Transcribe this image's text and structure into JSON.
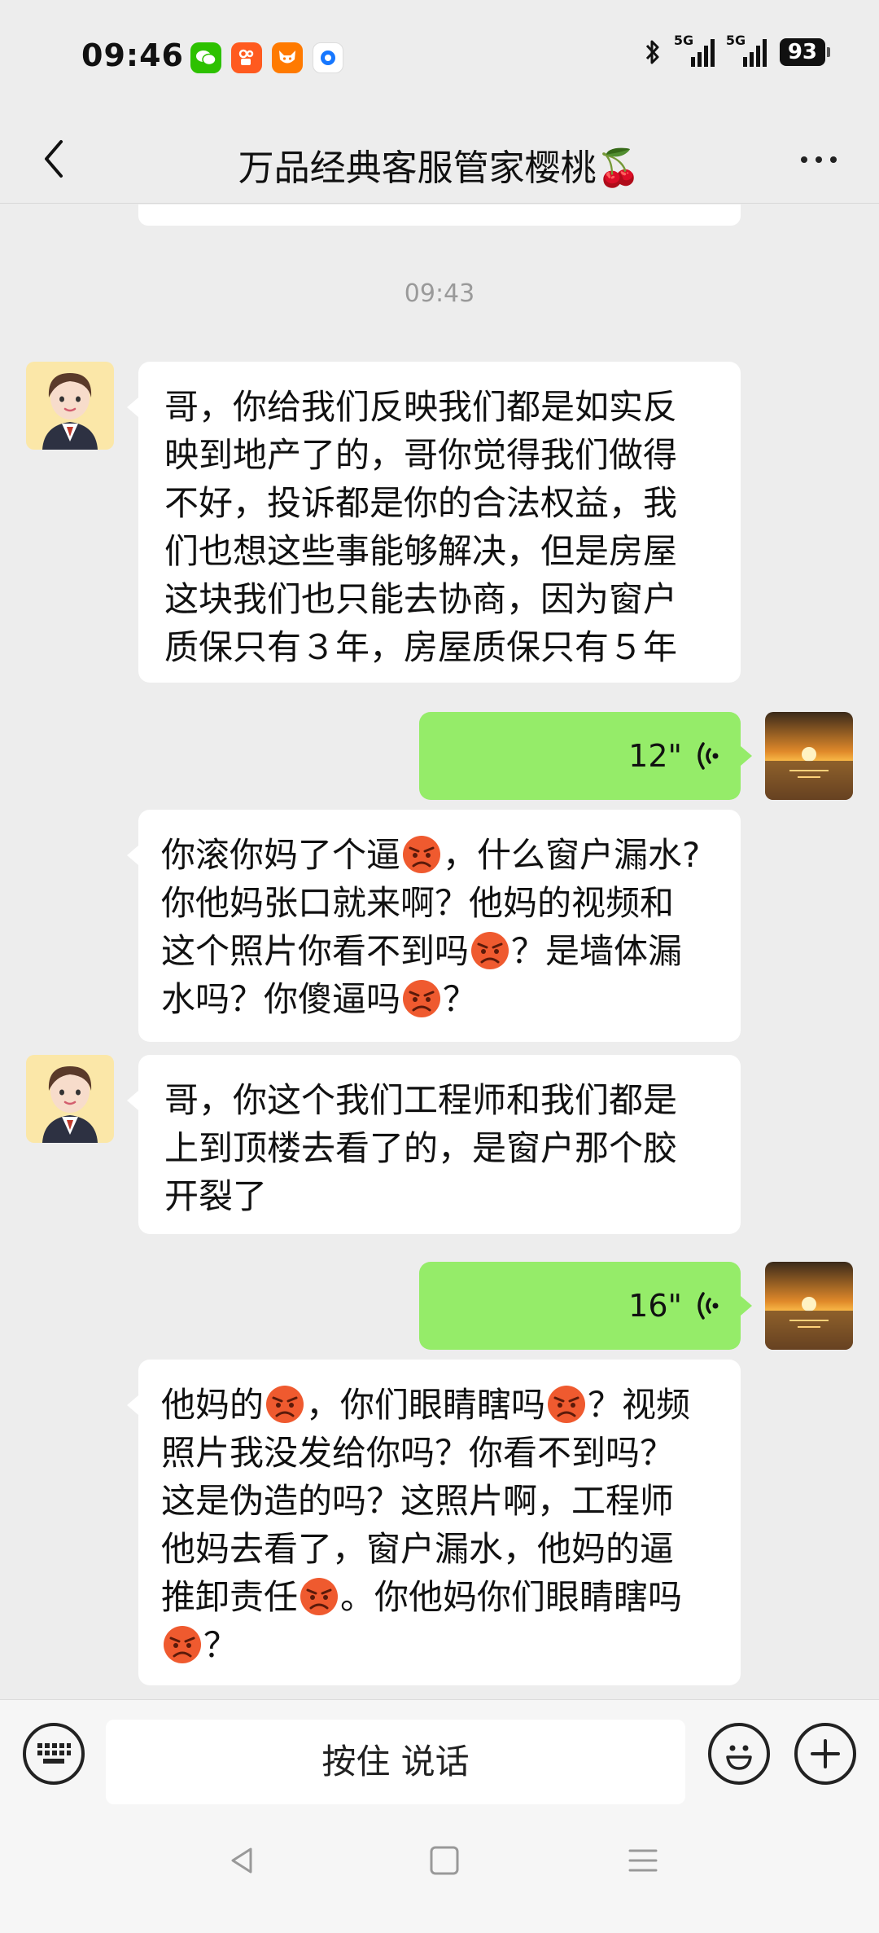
{
  "status_bar": {
    "time": "09:46",
    "signal1_label": "5G",
    "signal2_label": "5G",
    "battery": "93"
  },
  "header": {
    "title": "万品经典客服管家樱桃🍒"
  },
  "chat": {
    "timestamp": "09:43",
    "messages": [
      {
        "side": "left",
        "type": "text",
        "lines": [
          "哥，你给我们反映我们都是如实反",
          "映到地产了的，哥你觉得我们做得",
          "不好，投诉都是你的合法权益，我",
          "们也想这些事能够解决，但是房屋",
          "这块我们也只能去协商，因为窗户",
          "质保只有３年，房屋质保只有５年"
        ]
      },
      {
        "side": "right",
        "type": "voice",
        "duration": "12\""
      },
      {
        "side": "left",
        "type": "text",
        "lines": [
          "你滚你妈了个逼😡，什么窗户漏水?",
          "你他妈张口就来啊？他妈的视频和",
          "这个照片你看不到吗😡？是墙体漏",
          "水吗？你傻逼吗😡？"
        ]
      },
      {
        "side": "left",
        "type": "text",
        "lines": [
          "哥，你这个我们工程师和我们都是",
          "上到顶楼去看了的，是窗户那个胶",
          "开裂了"
        ]
      },
      {
        "side": "right",
        "type": "voice",
        "duration": "16\""
      },
      {
        "side": "left",
        "type": "text",
        "lines": [
          "他妈的😡，你们眼睛瞎吗😡？视频",
          "照片我没发给你吗？你看不到吗？",
          "这是伪造的吗？这照片啊，工程师",
          "他妈去看了，窗户漏水，他妈的逼",
          "推卸责任😡。你他妈你们眼睛瞎吗",
          "😡？"
        ]
      }
    ]
  },
  "input_bar": {
    "hold_to_talk": "按住 说话"
  },
  "icons": {
    "back": "chevron-left-icon",
    "more": "more-dots-icon",
    "keyboard": "keyboard-icon",
    "emoji": "smiley-icon",
    "plus": "plus-icon",
    "voice": "voice-wave-icon",
    "angry": "angry-face-icon"
  },
  "colors": {
    "background": "#ededed",
    "sent_bubble": "#95ec69",
    "received_bubble": "#ffffff",
    "timestamp": "#9a9a9a"
  }
}
